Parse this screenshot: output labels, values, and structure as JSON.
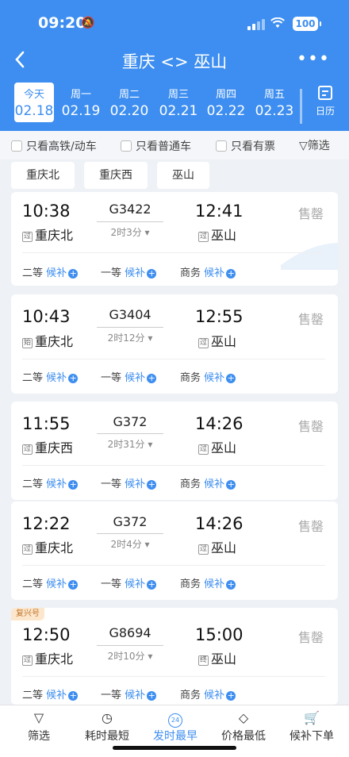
{
  "status": {
    "time": "09:20",
    "battery": "100"
  },
  "header": {
    "title": "重庆 <> 巫山",
    "more": "•••"
  },
  "dates": [
    {
      "weekday": "今天",
      "date": "02.18",
      "active": true
    },
    {
      "weekday": "周一",
      "date": "02.19"
    },
    {
      "weekday": "周二",
      "date": "02.20"
    },
    {
      "weekday": "周三",
      "date": "02.21"
    },
    {
      "weekday": "周四",
      "date": "02.22"
    },
    {
      "weekday": "周五",
      "date": "02.23"
    }
  ],
  "calendar_label": "日历",
  "filters": {
    "high_speed": "只看高铁/动车",
    "normal": "只看普通车",
    "has_ticket": "只看有票",
    "filter": "筛选"
  },
  "stations": [
    "重庆北",
    "重庆西",
    "巫山"
  ],
  "trains": [
    {
      "dep": "10:38",
      "from_mark": "过",
      "from": "重庆北",
      "no": "G3422",
      "dur": "2时3分",
      "arr": "12:41",
      "to_mark": "过",
      "to": "巫山",
      "status": "售罄"
    },
    {
      "dep": "10:43",
      "from_mark": "始",
      "from": "重庆北",
      "no": "G3404",
      "dur": "2时12分",
      "arr": "12:55",
      "to_mark": "过",
      "to": "巫山",
      "status": "售罄"
    },
    {
      "dep": "11:55",
      "from_mark": "过",
      "from": "重庆西",
      "no": "G372",
      "dur": "2时31分",
      "arr": "14:26",
      "to_mark": "过",
      "to": "巫山",
      "status": "售罄"
    },
    {
      "dep": "12:22",
      "from_mark": "过",
      "from": "重庆北",
      "no": "G372",
      "dur": "2时4分",
      "arr": "14:26",
      "to_mark": "过",
      "to": "巫山",
      "status": "售罄"
    },
    {
      "tag": "复兴号",
      "dep": "12:50",
      "from_mark": "过",
      "from": "重庆北",
      "no": "G8694",
      "dur": "2时10分",
      "arr": "15:00",
      "to_mark": "终",
      "to": "巫山",
      "status": "售罄"
    }
  ],
  "seats": {
    "second": "二等",
    "first": "一等",
    "business": "商务",
    "waitlist": "候补"
  },
  "bottom": {
    "filter": "筛选",
    "shortest": "耗时最短",
    "earliest": "发时最早",
    "earliest_icon_text": "24",
    "cheapest": "价格最低",
    "waitlist_order": "候补下单"
  }
}
